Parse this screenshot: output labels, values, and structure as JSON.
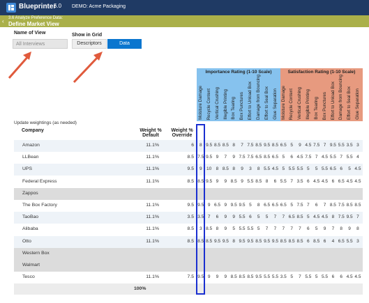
{
  "app": {
    "title": "Blueprinter",
    "version": "5.0",
    "demo_label": "DEMO: Acme Packaging"
  },
  "header": {
    "step": "3.6 Analyze Preference Data:",
    "title": "Define Market View",
    "back_icon": "chevron-left-icon"
  },
  "view": {
    "name_label": "Name of View",
    "name_value": "All Interviews"
  },
  "show_grid": {
    "label": "Show in Grid",
    "options": [
      "Descriptors",
      "Data"
    ],
    "selected": "Data"
  },
  "colors": {
    "topbar": "#1f3a64",
    "subbar": "#aab04a",
    "accent": "#0b76cf",
    "importance": "#86c2ee",
    "satisfaction": "#e79a7f",
    "highlight": "#1a2fd0",
    "arrow": "#e05a3c",
    "green_arrow": "#6bb13d"
  },
  "groups": {
    "importance": "Importance Rating (1-10 Scale)",
    "satisfaction": "Satisfaction Rating (1-10 Scale)"
  },
  "attributes": [
    "Moisture Damage",
    "Recycle Content",
    "Vertical Crushing",
    "Illegible Printing",
    "Box Tearing",
    "Box Punctures",
    "Effort to Unload Box",
    "Damage from Bouncing",
    "Effort to Seal Box",
    "Glue Separation"
  ],
  "table": {
    "note": "Update weightings (as needed)",
    "col_company": "Company",
    "col_default": "Weight % Default",
    "col_override": "Weight % Override",
    "rows": [
      {
        "company": "Amazon",
        "default": "11.1%",
        "override": "6",
        "imp": [
          "8",
          "9.5",
          "8.5",
          "8.5",
          "8",
          "7",
          "7.5",
          "8.5",
          "9.5",
          "8.5"
        ],
        "sat": [
          "6.5",
          "5",
          "9",
          "4.5",
          "7.5",
          "7",
          "9.5",
          "5.5",
          "3.5",
          "3"
        ]
      },
      {
        "company": "LLBean",
        "default": "11.1%",
        "override": "8.5",
        "imp": [
          "7.5",
          "9.5",
          "9",
          "7",
          "9",
          "7.5",
          "7.5",
          "6.5",
          "8.5",
          "6.5"
        ],
        "sat": [
          "5",
          "6",
          "4.5",
          "7.5",
          "7",
          "4.5",
          "5.5",
          "7",
          "5.5",
          "4"
        ]
      },
      {
        "company": "UPS",
        "default": "11.1%",
        "override": "9.5",
        "imp": [
          "9",
          "10",
          "8",
          "8.5",
          "8",
          "9",
          "3",
          "8",
          "5.5",
          "4.5"
        ],
        "sat": [
          "5",
          "5.5",
          "5.5",
          "5",
          "5",
          "5.5",
          "6.5",
          "6",
          "5",
          "4.5"
        ]
      },
      {
        "company": "Federal Express",
        "default": "11.1%",
        "override": "8.5",
        "imp": [
          "8.5",
          "9.5",
          "9",
          "9",
          "8.5",
          "9",
          "5.5",
          "8.5",
          "8",
          "6"
        ],
        "sat": [
          "5.5",
          "7",
          "3.5",
          "6",
          "4.5",
          "4.5",
          "6",
          "6.5",
          "4.5",
          "4.5"
        ]
      },
      {
        "company": "Zappos",
        "default": "",
        "override": "",
        "imp": [],
        "sat": [],
        "group": true
      },
      {
        "company": "The Box Factory",
        "default": "11.1%",
        "override": "9.5",
        "imp": [
          "9.5",
          "9",
          "6.5",
          "9",
          "9.5",
          "9.5",
          "5",
          "8",
          "6.5",
          "6.5"
        ],
        "sat": [
          "6.5",
          "5",
          "7.5",
          "7",
          "6",
          "7",
          "8.5",
          "7.5",
          "8.5",
          "8.5"
        ]
      },
      {
        "company": "TaoBao",
        "default": "11.1%",
        "override": "3.5",
        "imp": [
          "3.5",
          "7",
          "6",
          "9",
          "9",
          "5.5",
          "6",
          "5",
          "5",
          "7"
        ],
        "sat": [
          "7",
          "6.5",
          "8.5",
          "5",
          "4.5",
          "4.5",
          "8",
          "7.5",
          "9.5",
          "7"
        ]
      },
      {
        "company": "Alibaba",
        "default": "11.1%",
        "override": "8.5",
        "imp": [
          "3",
          "8.5",
          "8",
          "9",
          "5",
          "5.5",
          "5.5",
          "5",
          "7",
          "7"
        ],
        "sat": [
          "7",
          "7",
          "7",
          "6",
          "5",
          "9",
          "7",
          "8",
          "9",
          "8"
        ]
      },
      {
        "company": "Otto",
        "default": "11.1%",
        "override": "8.5",
        "imp": [
          "8.5",
          "8.5",
          "9.5",
          "9.5",
          "8",
          "9.5",
          "9.5",
          "8.5",
          "9.5",
          "9.5"
        ],
        "sat": [
          "8.5",
          "8.5",
          "8.5",
          "6",
          "8.5",
          "6",
          "4",
          "6.5",
          "5.5",
          "3"
        ]
      },
      {
        "company": "Western Box",
        "default": "",
        "override": "",
        "imp": [],
        "sat": [],
        "group": true
      },
      {
        "company": "Walmart",
        "default": "",
        "override": "",
        "imp": [],
        "sat": [],
        "group": true
      },
      {
        "company": "Tesco",
        "default": "11.1%",
        "override": "7.5",
        "imp": [
          "9.5",
          "9",
          "9",
          "9",
          "8.5",
          "8.5",
          "8.5",
          "9.5",
          "5.5",
          "5.5"
        ],
        "sat": [
          "3.5",
          "5",
          "7",
          "5.5",
          "5",
          "5.5",
          "6",
          "6",
          "4.5",
          "4.5"
        ]
      }
    ],
    "total_default": "100%"
  }
}
